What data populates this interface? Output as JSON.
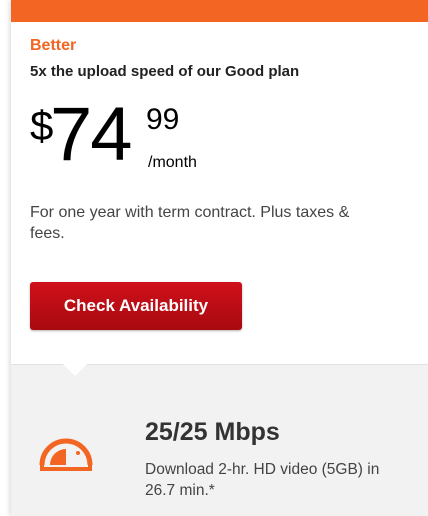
{
  "plan": {
    "tier": "Better",
    "tagline": "5x the upload speed of our Good plan",
    "price": {
      "currency": "$",
      "dollars": "74",
      "cents": "99",
      "period": "/month"
    },
    "terms": "For one year with term contract. Plus taxes & fees.",
    "cta_label": "Check Availability"
  },
  "feature": {
    "icon": "speedometer-icon",
    "speed": "25/25 Mbps",
    "description": "Download 2-hr. HD video (5GB) in 26.7 min.*"
  },
  "colors": {
    "accent": "#f26522",
    "button": "#c00d15",
    "feature_bg": "#f2f2f2"
  }
}
